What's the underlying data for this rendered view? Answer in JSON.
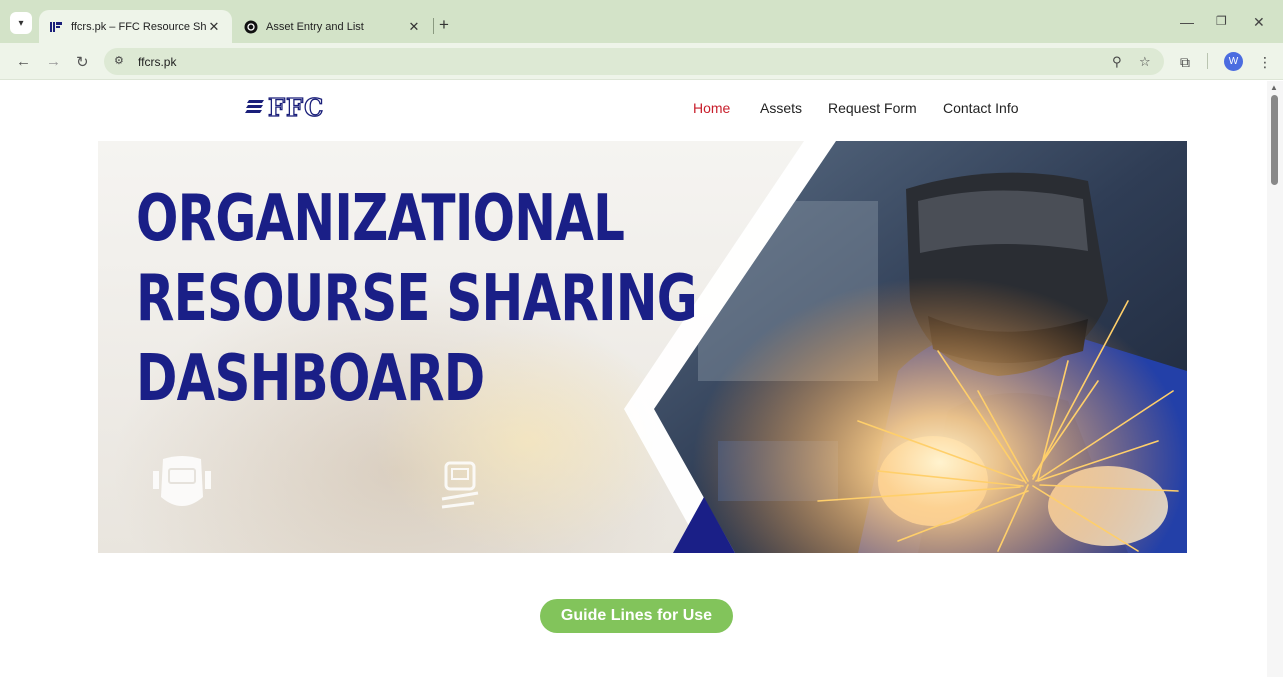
{
  "browser": {
    "tabs": [
      {
        "title": "ffcrs.pk – FFC Resource Sharing",
        "active": true
      },
      {
        "title": "Asset Entry and List",
        "active": false
      }
    ],
    "url": "ffcrs.pk",
    "profile_initial": "W"
  },
  "site": {
    "logo_text": "FFC",
    "nav": [
      {
        "label": "Home",
        "active": true
      },
      {
        "label": "Assets",
        "active": false
      },
      {
        "label": "Request Form",
        "active": false
      },
      {
        "label": "Contact Info",
        "active": false
      }
    ],
    "hero": {
      "lines": [
        "ORGANIZATIONAL",
        "RESOURSE SHARING",
        "DASHBOARD"
      ]
    },
    "guide_button": "Guide Lines for Use"
  },
  "colors": {
    "brand_navy": "#1a1f87",
    "nav_active": "#c81e2b",
    "guide_green": "#82c45b",
    "chrome_tabstrip": "#d3e3c8"
  }
}
